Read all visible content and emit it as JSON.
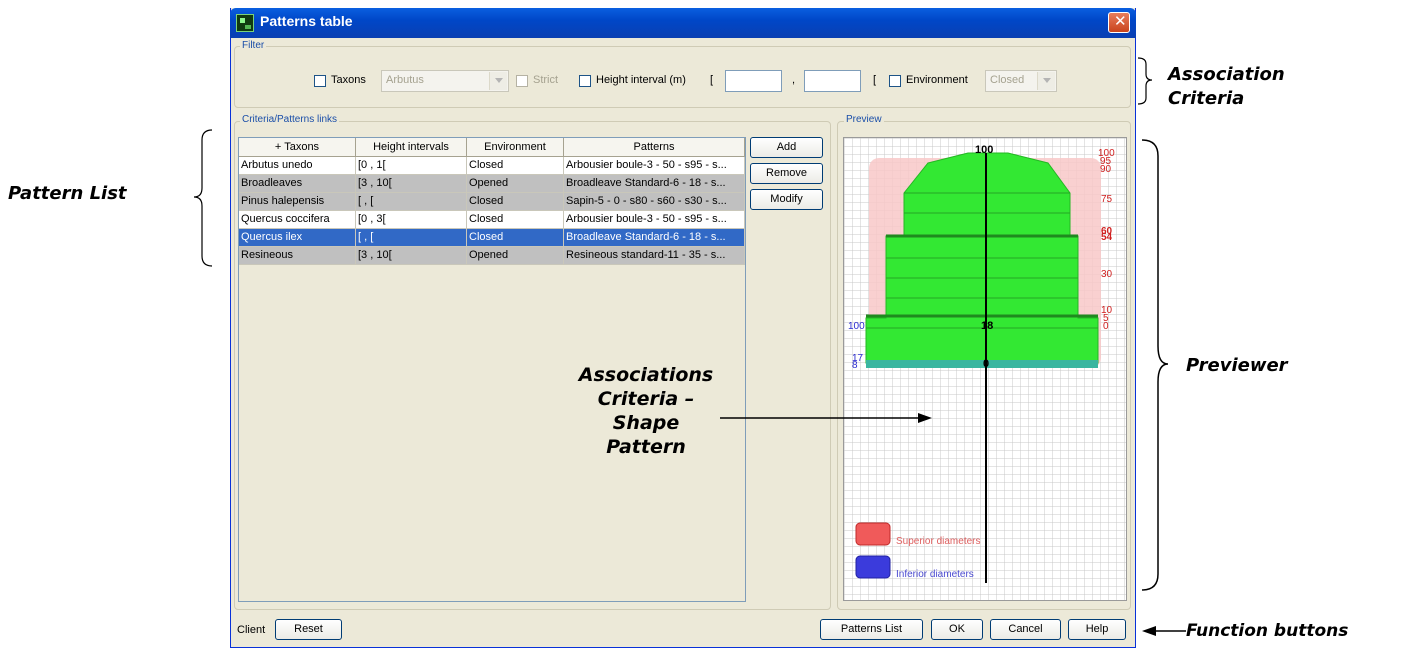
{
  "window": {
    "title": "Patterns table"
  },
  "filter": {
    "group_label": "Filter",
    "taxons_label": "Taxons",
    "taxons_value": "Arbutus",
    "strict_label": "Strict",
    "height_label": "Height interval (m)",
    "open_bracket": "[",
    "comma": ",",
    "close_bracket": "[",
    "height_min": "",
    "height_max": "",
    "environment_label": "Environment",
    "environment_value": "Closed"
  },
  "links": {
    "group_label": "Criteria/Patterns links",
    "columns": [
      "+ Taxons",
      "Height intervals",
      "Environment",
      "Patterns"
    ],
    "rows": [
      {
        "taxon": "Arbutus unedo",
        "height": "[0 , 1[",
        "env": "Closed",
        "pattern": "Arbousier boule-3 - 50 - s95 - s..."
      },
      {
        "taxon": "Broadleaves",
        "height": "[3 , 10[",
        "env": "Opened",
        "pattern": "Broadleave Standard-6 - 18 - s..."
      },
      {
        "taxon": "Pinus halepensis",
        "height": "[ , [",
        "env": "Closed",
        "pattern": "Sapin-5 - 0 - s80 - s60 - s30 - s..."
      },
      {
        "taxon": "Quercus coccifera",
        "height": "[0 , 3[",
        "env": "Closed",
        "pattern": "Arbousier boule-3 - 50 - s95 - s..."
      },
      {
        "taxon": "Quercus ilex",
        "height": "[ , [",
        "env": "Closed",
        "pattern": "Broadleave Standard-6 - 18 - s..."
      },
      {
        "taxon": "Resineous",
        "height": "[3 , 10[",
        "env": "Opened",
        "pattern": "Resineous standard-11 - 35 - s..."
      }
    ],
    "buttons": {
      "add": "Add",
      "remove": "Remove",
      "modify": "Modify"
    }
  },
  "preview": {
    "group_label": "Preview",
    "top_label": "100",
    "center_label": "18",
    "zero_label": "0",
    "left_label": "100",
    "left_small_label": "17",
    "left_small_label2": "8",
    "right_labels": [
      "100",
      "95",
      "90",
      "75",
      "60",
      "54",
      "30",
      "10",
      "5",
      "0"
    ],
    "legend_superior": "Superior diameters",
    "legend_inferior": "Inferior diameters",
    "colors": {
      "superior": "#f05a5a",
      "inferior": "#3b3bdc",
      "crown": "#33e833",
      "bg_area": "#f8c8c8"
    }
  },
  "bottom": {
    "client_label": "Client",
    "reset": "Reset",
    "patterns_list": "Patterns List",
    "ok": "OK",
    "cancel": "Cancel",
    "help": "Help"
  },
  "annotations": {
    "association_criteria_line1": "Association",
    "association_criteria_line2": "Criteria",
    "pattern_list": "Pattern List",
    "previewer": "Previewer",
    "shape_line1": "Associations",
    "shape_line2": "Criteria –",
    "shape_line3": "Shape",
    "shape_line4": "Pattern",
    "function_buttons": "Function buttons"
  }
}
